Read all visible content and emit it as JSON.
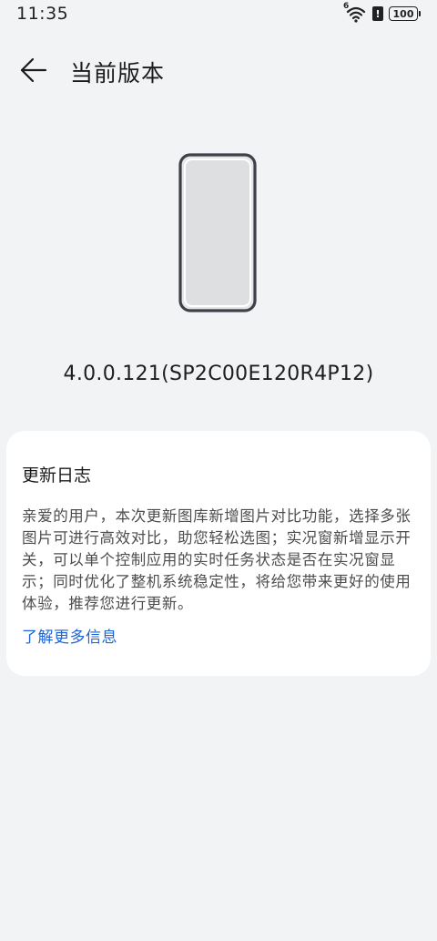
{
  "status_bar": {
    "time": "11:35",
    "network_label": "6",
    "alert_glyph": "!",
    "battery_level": "100"
  },
  "header": {
    "title": "当前版本",
    "back_icon": "arrow-left-icon"
  },
  "device": {
    "icon": "phone-outline-icon"
  },
  "version": {
    "text": "4.0.0.121(SP2C00E120R4P12)"
  },
  "changelog": {
    "title": "更新日志",
    "body": "亲爱的用户，本次更新图库新增图片对比功能，选择多张图片可进行高效对比，助您轻松选图；实况窗新增显示开关，可以单个控制应用的实时任务状态是否在实况窗显示；同时优化了整机系统稳定性，将给您带来更好的使用体验，推荐您进行更新。",
    "link_label": "了解更多信息"
  },
  "colors": {
    "background": "#f1f3f5",
    "card": "#ffffff",
    "link": "#1e63d6"
  }
}
